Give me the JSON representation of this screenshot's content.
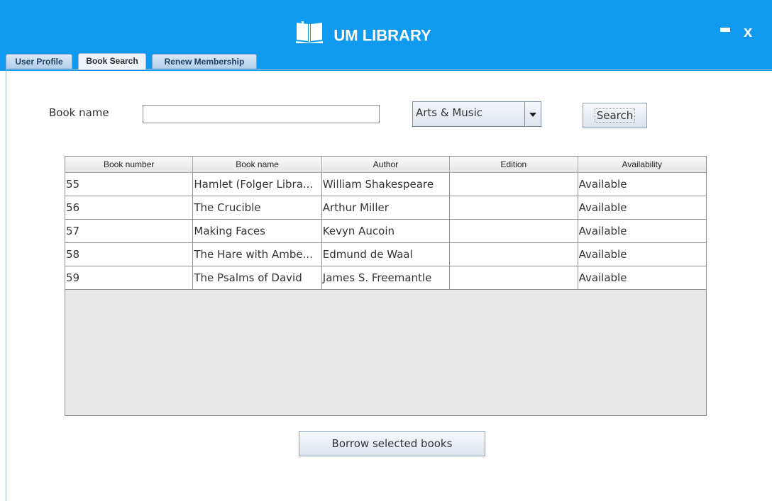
{
  "app": {
    "title": "UM LIBRARY",
    "minimize_label": "-",
    "close_label": "x"
  },
  "tabs": [
    {
      "label": "User Profile",
      "active": false
    },
    {
      "label": "Book Search",
      "active": true
    },
    {
      "label": "Renew Membership",
      "active": false
    }
  ],
  "search": {
    "label": "Book name",
    "value": "",
    "placeholder": "",
    "category": "Arts & Music",
    "search_button": "Search"
  },
  "table": {
    "columns": [
      "Book number",
      "Book name",
      "Author",
      "Edition",
      "Availability"
    ],
    "rows": [
      [
        "55",
        "Hamlet (Folger Libra...",
        "William Shakespeare",
        "",
        "Available"
      ],
      [
        "56",
        "The Crucible",
        "Arthur Miller",
        "",
        "Available"
      ],
      [
        "57",
        "Making Faces",
        "Kevyn Aucoin",
        "",
        "Available"
      ],
      [
        "58",
        "The Hare with Ambe...",
        "Edmund de Waal",
        "",
        "Available"
      ],
      [
        "59",
        "The Psalms of David",
        "James S. Freemantle",
        "",
        "Available"
      ]
    ]
  },
  "actions": {
    "borrow_button": "Borrow selected books"
  },
  "colors": {
    "header_bg": "#0f9aef",
    "header_text": "#ffffff"
  }
}
